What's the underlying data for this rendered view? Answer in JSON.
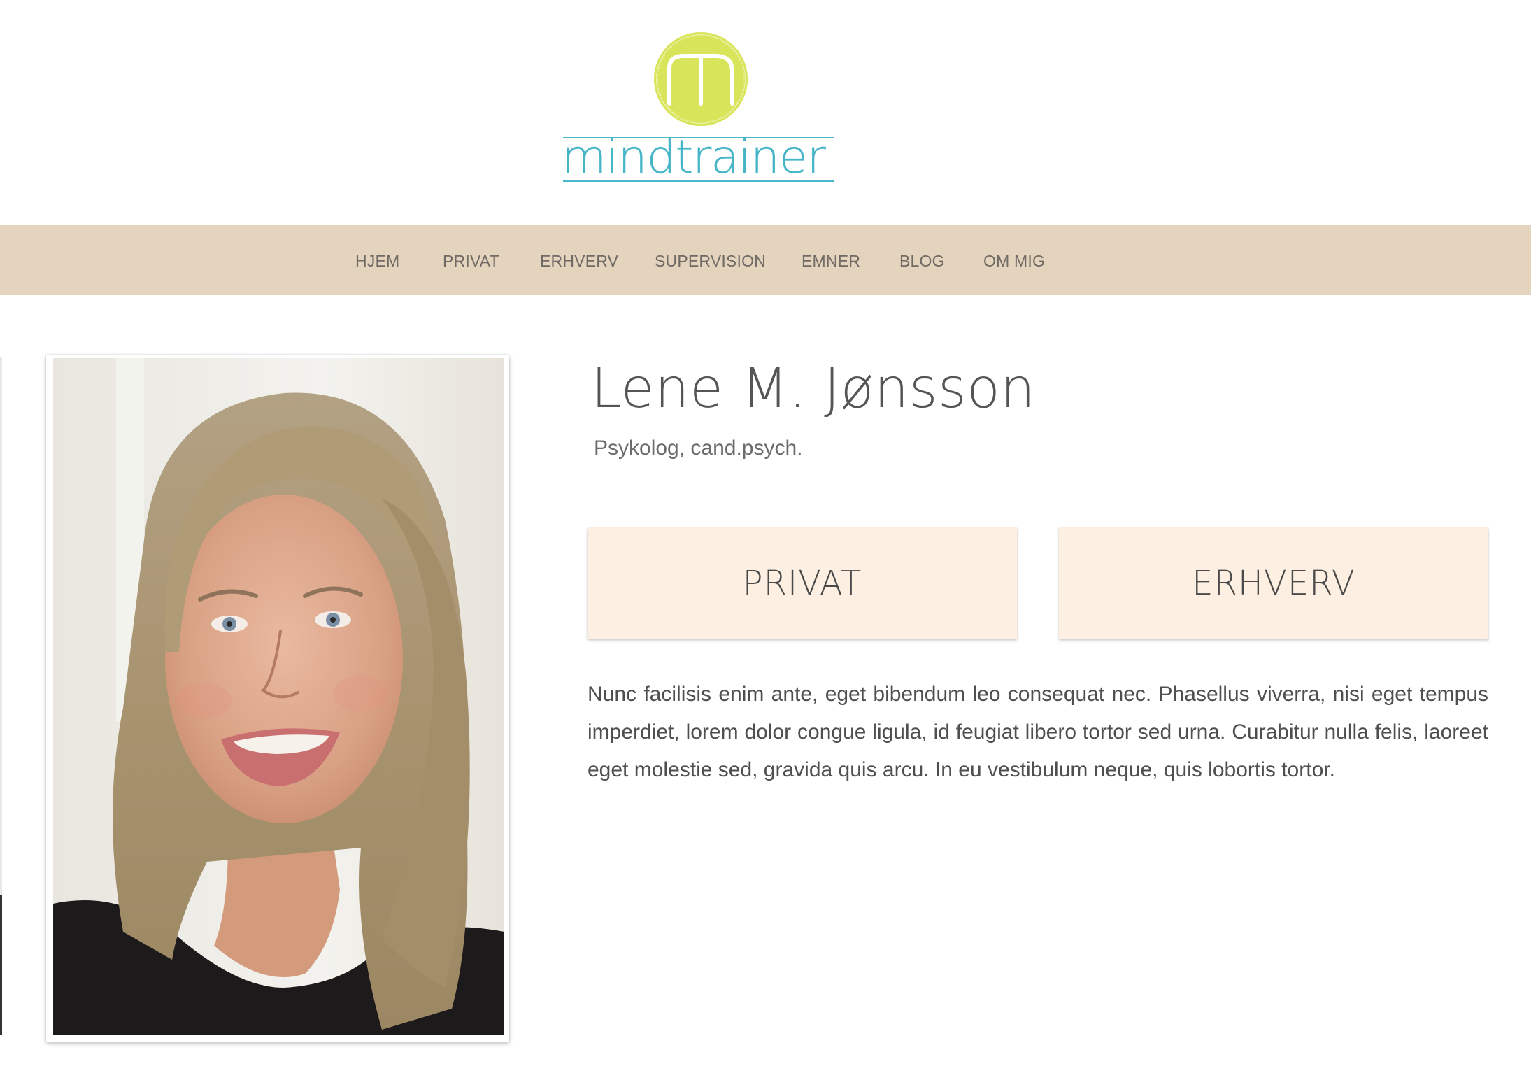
{
  "logo": {
    "wordmark": "mindtrainer",
    "badge_letter": "m",
    "colors": {
      "badge": "#d8e55a",
      "wordmark": "#45b5c7"
    }
  },
  "nav": {
    "items": [
      {
        "label": "HJEM"
      },
      {
        "label": "PRIVAT"
      },
      {
        "label": "ERHVERV"
      },
      {
        "label": "SUPERVISION"
      },
      {
        "label": "EMNER"
      },
      {
        "label": "BLOG"
      },
      {
        "label": "OM MIG"
      }
    ],
    "background": "#e4d4be"
  },
  "profile": {
    "name": "Lene M. Jønsson",
    "title": "Psykolog, cand.psych."
  },
  "cards": {
    "privat": "PRIVAT",
    "erhverv": "ERHVERV",
    "background": "#fdf0e3"
  },
  "content": {
    "paragraph": "Nunc facilisis enim ante, eget bibendum leo consequat nec. Phasellus viverra, nisi eget tempus imperdiet, lorem dolor congue ligula, id feugiat libero tortor sed urna. Curabitur nulla felis, laoreet eget molestie sed, gravida quis arcu. In eu vestibulum neque, quis lobortis tortor."
  }
}
